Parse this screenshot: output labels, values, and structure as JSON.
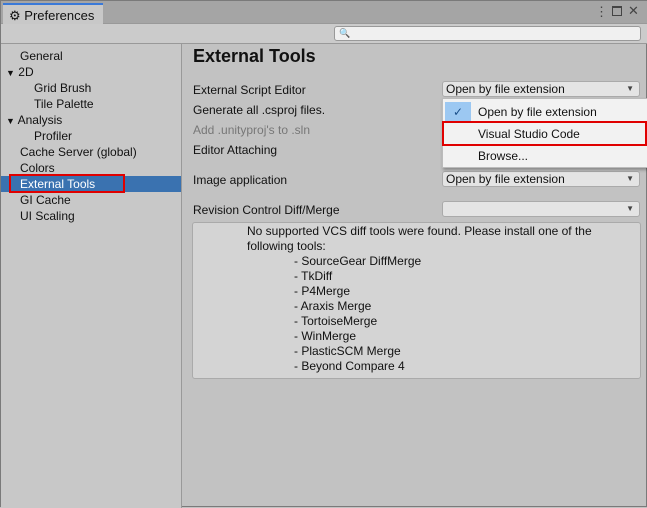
{
  "window": {
    "title": "Preferences",
    "search_placeholder": ""
  },
  "sidebar": {
    "items": [
      {
        "label": "General"
      },
      {
        "label": "2D"
      },
      {
        "label": "Grid Brush"
      },
      {
        "label": "Tile Palette"
      },
      {
        "label": "Analysis"
      },
      {
        "label": "Profiler"
      },
      {
        "label": "Cache Server (global)"
      },
      {
        "label": "Colors"
      },
      {
        "label": "External Tools"
      },
      {
        "label": "GI Cache"
      },
      {
        "label": "UI Scaling"
      }
    ]
  },
  "main": {
    "title": "External Tools",
    "external_script_editor": {
      "label": "External Script Editor",
      "value": "Open by file extension"
    },
    "generate_csproj": "Generate all .csproj files.",
    "add_unityproj": "Add .unityproj's to .sln",
    "editor_attaching": "Editor Attaching",
    "image_application": {
      "label": "Image application",
      "value": "Open by file extension"
    },
    "revision_control": {
      "label": "Revision Control Diff/Merge",
      "value": ""
    },
    "menu": [
      "Open by file extension",
      "Visual Studio Code",
      "Browse..."
    ],
    "info": {
      "message_line1": "No supported VCS diff tools were found. Please install one of the",
      "message_line2": "following tools:",
      "tools": [
        "- SourceGear DiffMerge",
        "- TkDiff",
        "- P4Merge",
        "- Araxis Merge",
        "- TortoiseMerge",
        "- WinMerge",
        "- PlasticSCM Merge",
        "- Beyond Compare 4"
      ]
    }
  },
  "colors": {
    "accent": "#3a72b0",
    "highlight": "#e00000"
  }
}
